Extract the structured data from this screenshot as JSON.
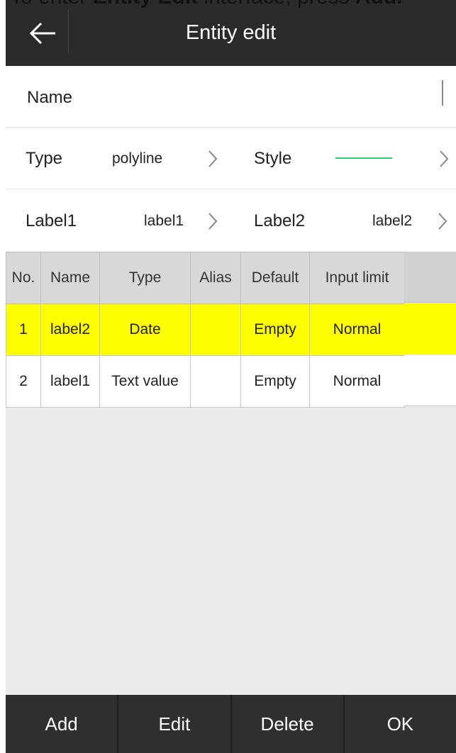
{
  "caption": {
    "prefix": "To enter ",
    "bold1": "Entity Edit",
    "middle": " interface, press ",
    "bold2": "Add."
  },
  "header": {
    "title": "Entity edit"
  },
  "form": {
    "name_label": "Name",
    "type_label": "Type",
    "type_value": "polyline",
    "style_label": "Style",
    "style_line_color": "#2ecc71",
    "label1_label": "Label1",
    "label1_value": "label1",
    "label2_label": "Label2",
    "label2_value": "label2"
  },
  "table": {
    "columns": [
      "No.",
      "Name",
      "Type",
      "Alias",
      "Default",
      "Input limit"
    ],
    "rows": [
      {
        "no": "1",
        "name": "label2",
        "type": "Date",
        "alias": "",
        "default": "Empty",
        "input_limit": "Normal",
        "selected": true
      },
      {
        "no": "2",
        "name": "label1",
        "type": "Text value",
        "alias": "",
        "default": "Empty",
        "input_limit": "Normal",
        "selected": false
      }
    ],
    "selected_color": "#ffff00"
  },
  "actions": {
    "add": "Add",
    "edit": "Edit",
    "delete": "Delete",
    "ok": "OK"
  },
  "colors": {
    "topbar": "#2b2b2b",
    "bottombar": "#2f2f2f",
    "background": "#ebebeb"
  }
}
